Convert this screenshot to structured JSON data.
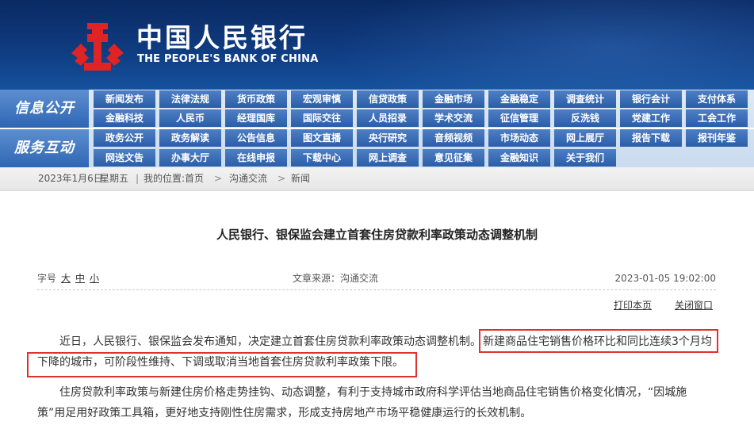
{
  "header": {
    "bank_name_cn": "中国人民银行",
    "bank_name_en": "THE PEOPLE'S BANK OF CHINA",
    "logo_icon": "pboc-logo-icon",
    "logo_color": "#e02424"
  },
  "nav": {
    "section1_label": "信息公开",
    "section2_label": "服务互动",
    "rows": [
      [
        "新闻发布",
        "法律法规",
        "货币政策",
        "宏观审慎",
        "信贷政策",
        "金融市场",
        "金融稳定",
        "调查统计",
        "银行会计",
        "支付体系"
      ],
      [
        "金融科技",
        "人民币",
        "经理国库",
        "国际交往",
        "人员招录",
        "学术交流",
        "征信管理",
        "反洗钱",
        "党建工作",
        "工会工作"
      ],
      [
        "政务公开",
        "政务解读",
        "公告信息",
        "图文直播",
        "央行研究",
        "音频视频",
        "市场动态",
        "网上展厅",
        "报告下载",
        "报刊年鉴"
      ],
      [
        "网送文告",
        "办事大厅",
        "在线申报",
        "下载中心",
        "网上调查",
        "意见征集",
        "金融知识",
        "关于我们"
      ]
    ]
  },
  "breadcrumb": {
    "date": "2023年1月6日",
    "weekday": "星期五",
    "location_label": "我的位置:",
    "home": "首页",
    "level1": "沟通交流",
    "level2": "新闻",
    "separator": ">"
  },
  "article": {
    "title": "人民银行、银保监会建立首套住房贷款利率政策动态调整机制",
    "font_size_label": "字号",
    "font_size_large": "大",
    "font_size_medium": "中",
    "font_size_small": "小",
    "source_label": "文章来源：",
    "source": "沟通交流",
    "datetime": "2023-01-05 19:02:00",
    "print_label": "打印本页",
    "close_label": "关闭窗口",
    "para1_line1_normal": "近日，人民银行、银保监会发布通知，决定建立首套住房贷款利率政策动态调整机制。",
    "para1_line1_highlight": "新建商品住宅销售价格环比和同比连续3个月均",
    "para1_line2_highlight": "下降的城市，可阶段性维持、下调或取消当地首套住房贷款利率政策下限。",
    "para2_line1": "住房贷款利率政策与新建住房价格走势挂钩、动态调整，有利于支持城市政府科学评估当地商品住宅销售价格变化情况，“因城施",
    "para2_line2": "策”用足用好政策工具箱，更好地支持刚性住房需求，形成支持房地产市场平稳健康运行的长效机制。",
    "highlight_color": "#e0312e"
  }
}
